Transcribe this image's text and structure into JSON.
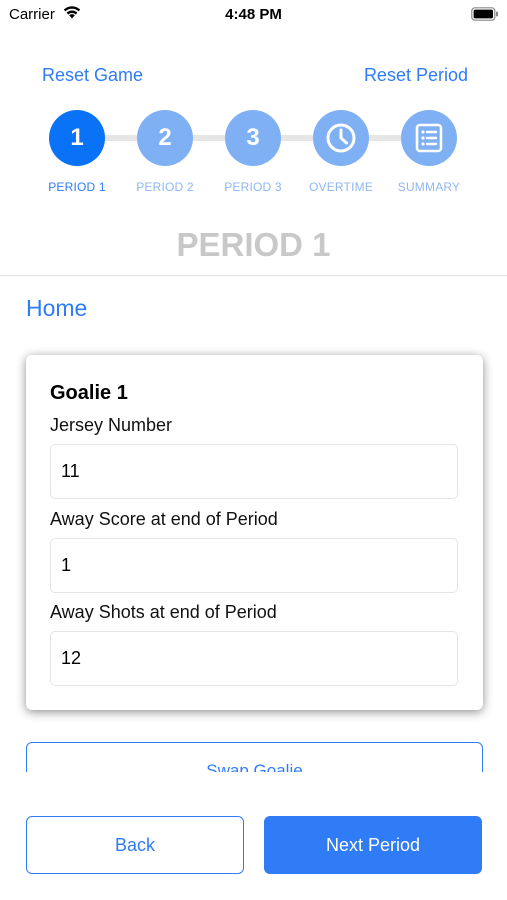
{
  "status_bar": {
    "carrier": "Carrier",
    "time": "4:48 PM"
  },
  "header": {
    "reset_game": "Reset Game",
    "reset_period": "Reset Period"
  },
  "stepper": {
    "active_index": 0,
    "steps": [
      {
        "circle": "1",
        "label": "PERIOD 1",
        "icon": "number-1"
      },
      {
        "circle": "2",
        "label": "PERIOD 2",
        "icon": "number-2"
      },
      {
        "circle": "3",
        "label": "PERIOD 3",
        "icon": "number-3"
      },
      {
        "circle": "",
        "label": "OVERTIME",
        "icon": "clock-icon"
      },
      {
        "circle": "",
        "label": "SUMMARY",
        "icon": "list-icon"
      }
    ]
  },
  "period_title": "PERIOD 1",
  "team_label": "Home",
  "goalie_card": {
    "title": "Goalie 1",
    "fields": [
      {
        "label": "Jersey Number",
        "value": "11"
      },
      {
        "label": "Away Score at end of Period",
        "value": "1"
      },
      {
        "label": "Away Shots at end of Period",
        "value": "12"
      }
    ]
  },
  "swap_goalie": "Swap Goalie",
  "footer": {
    "back": "Back",
    "next": "Next Period"
  },
  "colors": {
    "accent": "#2f7cf6",
    "active_step": "#0a72f7",
    "inactive_step": "#7fb0f4",
    "title_gray": "#c8c8c8"
  }
}
